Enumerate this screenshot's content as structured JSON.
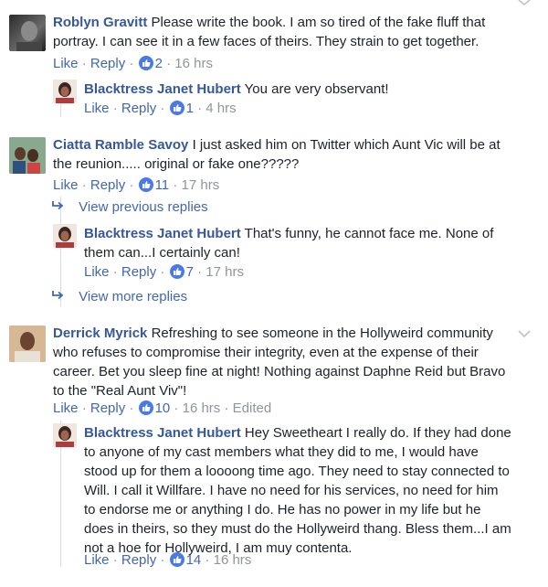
{
  "c1": {
    "author": "Roblyn Gravitt",
    "text": "Please write the book. I am so tired of the fake fluff that portray. I can see it in a few faces of theirs. They strain to get together.",
    "like": "Like",
    "reply": "Reply",
    "count": "2",
    "time": "16 hrs"
  },
  "r1": {
    "author": "Blacktress Janet Hubert",
    "text": "You are very observant!",
    "like": "Like",
    "reply": "Reply",
    "count": "1",
    "time": "4 hrs"
  },
  "c2": {
    "author": "Ciatta Ramble Savoy",
    "text": "I just asked him on Twitter which Aunt Vic will be at the reunion..... original or fake one?????",
    "like": "Like",
    "reply": "Reply",
    "count": "11",
    "time": "17 hrs"
  },
  "prev_replies": "View previous replies",
  "r2": {
    "author": "Blacktress Janet Hubert",
    "text": "That's funny, he cannot face me. None of them can...I certainly can!",
    "like": "Like",
    "reply": "Reply",
    "count": "7",
    "time": "17 hrs"
  },
  "more_replies": "View more replies",
  "c3": {
    "author": "Derrick Myrick",
    "text": "Refreshing to see someone in the Hollyweird community who refuses to compromise their integrity, even at the expense of their career. Bet you sleep fine at night! Nothing against Daphne Reid but Bravo to the \"Real Aunt Viv\"!",
    "like": "Like",
    "reply": "Reply",
    "count": "10",
    "time": "16 hrs",
    "edited": "Edited"
  },
  "r3": {
    "author": "Blacktress Janet Hubert",
    "text": "Hey Sweetheart I really do. If they had done to anyone of my cast members what they did to me, I would have stood up for them a loooong time ago. They need to stay connected to Will. I call it Willfare. I have no need for his services, no need for him to endorse me or anything I do. He has no power in my life but he does in theirs, so they must do the Hollyweird thang. Bless them...I am not a hoe for Hollyweird, I am muy contenta.",
    "like": "Like",
    "reply": "Reply",
    "count": "14",
    "time": "16 hrs"
  },
  "colors": {
    "link": "#365899",
    "action": "#4267b2",
    "meta": "#90949c",
    "like_icon": "#4a7ae9"
  },
  "icons": {
    "like": "thumbs-up-icon",
    "reply_arrow": "reply-arrow-icon",
    "options": "chevron-down-icon"
  }
}
